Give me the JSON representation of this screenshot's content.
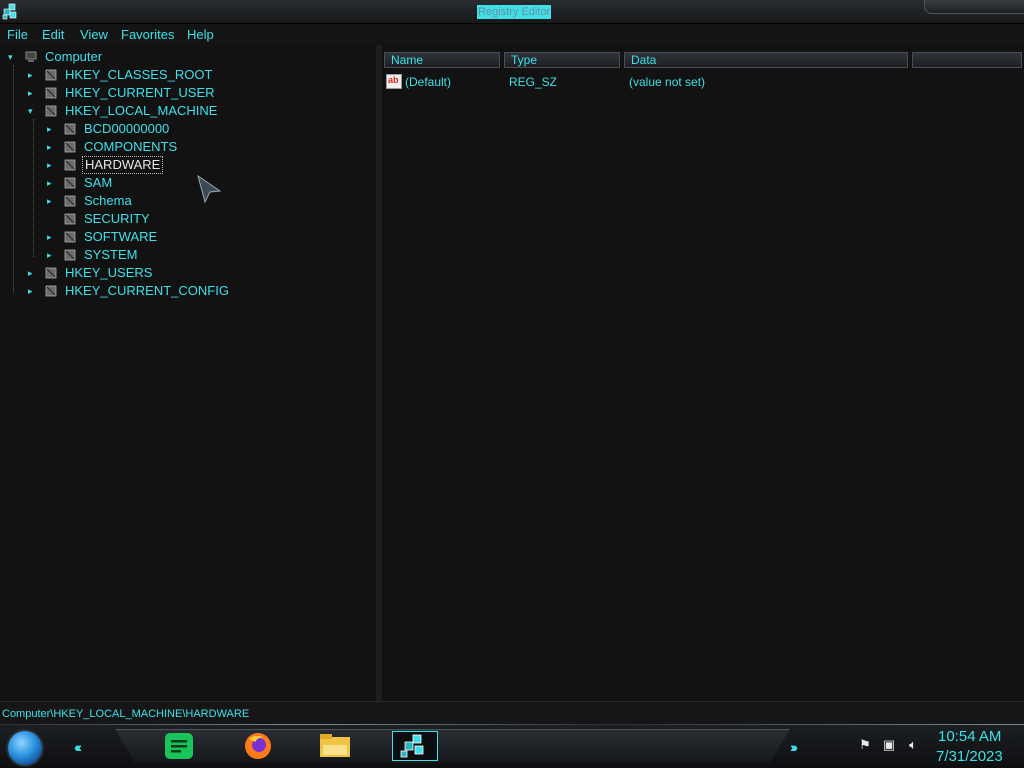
{
  "window": {
    "title": "Registry Editor"
  },
  "menu": [
    "File",
    "Edit",
    "View",
    "Favorites",
    "Help"
  ],
  "tree": {
    "root": "Computer",
    "items": [
      {
        "label": "HKEY_CLASSES_ROOT",
        "level": 1,
        "expander": "▸"
      },
      {
        "label": "HKEY_CURRENT_USER",
        "level": 1,
        "expander": "▸"
      },
      {
        "label": "HKEY_LOCAL_MACHINE",
        "level": 1,
        "expander": "▾"
      },
      {
        "label": "BCD00000000",
        "level": 2,
        "expander": "▸"
      },
      {
        "label": "COMPONENTS",
        "level": 2,
        "expander": "▸"
      },
      {
        "label": "HARDWARE",
        "level": 2,
        "expander": "▸",
        "selected": true
      },
      {
        "label": "SAM",
        "level": 2,
        "expander": "▸"
      },
      {
        "label": "Schema",
        "level": 2,
        "expander": "▸"
      },
      {
        "label": "SECURITY",
        "level": 2,
        "expander": ""
      },
      {
        "label": "SOFTWARE",
        "level": 2,
        "expander": "▸"
      },
      {
        "label": "SYSTEM",
        "level": 2,
        "expander": "▸"
      },
      {
        "label": "HKEY_USERS",
        "level": 1,
        "expander": "▸"
      },
      {
        "label": "HKEY_CURRENT_CONFIG",
        "level": 1,
        "expander": "▸"
      }
    ]
  },
  "list": {
    "columns": [
      "Name",
      "Type",
      "Data"
    ],
    "rows": [
      {
        "name": "(Default)",
        "type": "REG_SZ",
        "data": "(value not set)",
        "icon": "ab"
      }
    ]
  },
  "status": {
    "path": "Computer\\HKEY_LOCAL_MACHINE\\HARDWARE"
  },
  "taskbar": {
    "apps": [
      "notes-app-icon",
      "firefox-icon",
      "file-explorer-icon",
      "registry-editor-icon"
    ],
    "tray_icons": [
      "flag-icon",
      "network-icon",
      "volume-icon"
    ],
    "time": "10:54 AM",
    "date": "7/31/2023"
  },
  "colors": {
    "accent": "#3fe0e8",
    "background": "#121212"
  }
}
